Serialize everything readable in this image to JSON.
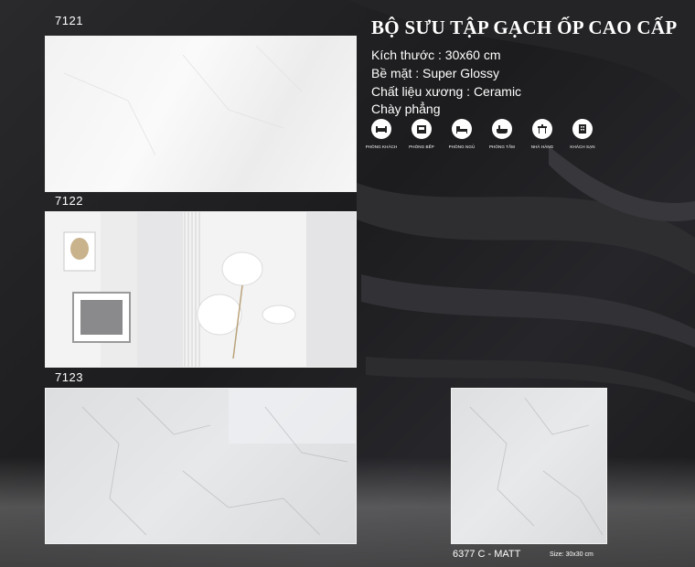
{
  "title": "BỘ SƯU TẬP GẠCH ỐP  CAO CẤP",
  "specs": {
    "size": "Kích thước : 30x60 cm",
    "surface": "Bề mặt :  Super Glossy",
    "material": "Chất liệu xương : Ceramic",
    "edge": "Chày phẳng"
  },
  "rooms": [
    {
      "label": "PHÒNG KHÁCH",
      "icon": "sofa-icon"
    },
    {
      "label": "PHÒNG BẾP",
      "icon": "kitchen-icon"
    },
    {
      "label": "PHÒNG NGỦ",
      "icon": "bed-icon"
    },
    {
      "label": "PHÒNG TẮM",
      "icon": "bathtub-icon"
    },
    {
      "label": "NHÀ HÀNG",
      "icon": "restaurant-icon"
    },
    {
      "label": "KHÁCH SẠN",
      "icon": "hotel-icon"
    }
  ],
  "tiles": [
    {
      "code": "7121"
    },
    {
      "code": "7122"
    },
    {
      "code": "7123"
    }
  ],
  "matt_tile": {
    "code": "6377 C - MATT",
    "size": "Size: 30x30 cm"
  },
  "colors": {
    "background": "#1e1e20",
    "text": "#ffffff"
  }
}
